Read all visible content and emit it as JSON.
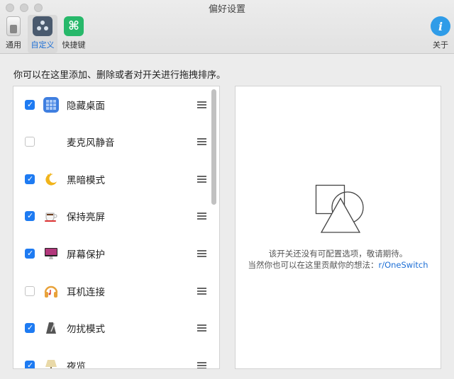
{
  "window": {
    "title": "偏好设置"
  },
  "toolbar": {
    "general_label": "通用",
    "custom_label": "自定义",
    "shortcut_label": "快捷键",
    "about_label": "关于",
    "shortcut_glyph": "⌘",
    "about_glyph": "i"
  },
  "instruction": "你可以在这里添加、删除或者对开关进行拖拽排序。",
  "items": [
    {
      "label": "隐藏桌面",
      "checked": true,
      "icon": "grid-icon"
    },
    {
      "label": "麦克风静音",
      "checked": false,
      "icon": "microphone-icon"
    },
    {
      "label": "黑暗模式",
      "checked": true,
      "icon": "moon-icon"
    },
    {
      "label": "保持亮屏",
      "checked": true,
      "icon": "coffee-cup-icon"
    },
    {
      "label": "屏幕保护",
      "checked": true,
      "icon": "imac-icon"
    },
    {
      "label": "耳机连接",
      "checked": false,
      "icon": "headphones-icon"
    },
    {
      "label": "勿扰模式",
      "checked": true,
      "icon": "metronome-icon"
    },
    {
      "label": "夜览",
      "checked": true,
      "icon": "lamp-icon"
    }
  ],
  "detail": {
    "empty_line1": "该开关还没有可配置选项，敬请期待。",
    "empty_line2_prefix": "当然你也可以在这里贡献你的想法：",
    "empty_link": "r/OneSwitch"
  },
  "colors": {
    "accent": "#1e7bf2",
    "link": "#1d6fd6"
  }
}
